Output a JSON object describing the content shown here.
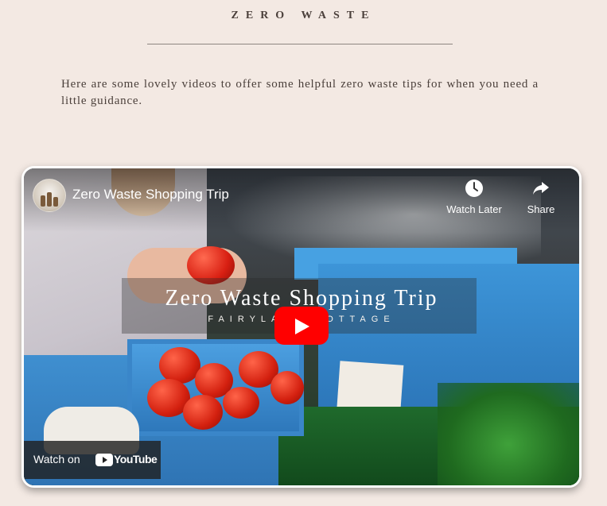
{
  "page": {
    "title": "ZERO WASTE",
    "intro": "Here are some lovely videos to offer some helpful zero waste tips for when you need a little guidance."
  },
  "video": {
    "title": "Zero Waste Shopping Trip",
    "overlay_title": "Zero Waste Shopping Trip",
    "overlay_subtitle": "FAIRYLAND COTTAGE",
    "watch_later_label": "Watch Later",
    "share_label": "Share",
    "watch_on_label": "Watch on",
    "youtube_label": "YouTube",
    "icons": {
      "watch_later": "clock-icon",
      "share": "share-arrow-icon",
      "play": "play-icon",
      "youtube": "youtube-logo-icon"
    },
    "colors": {
      "play_button": "#ff0000",
      "frame_border": "#ffffff"
    }
  }
}
